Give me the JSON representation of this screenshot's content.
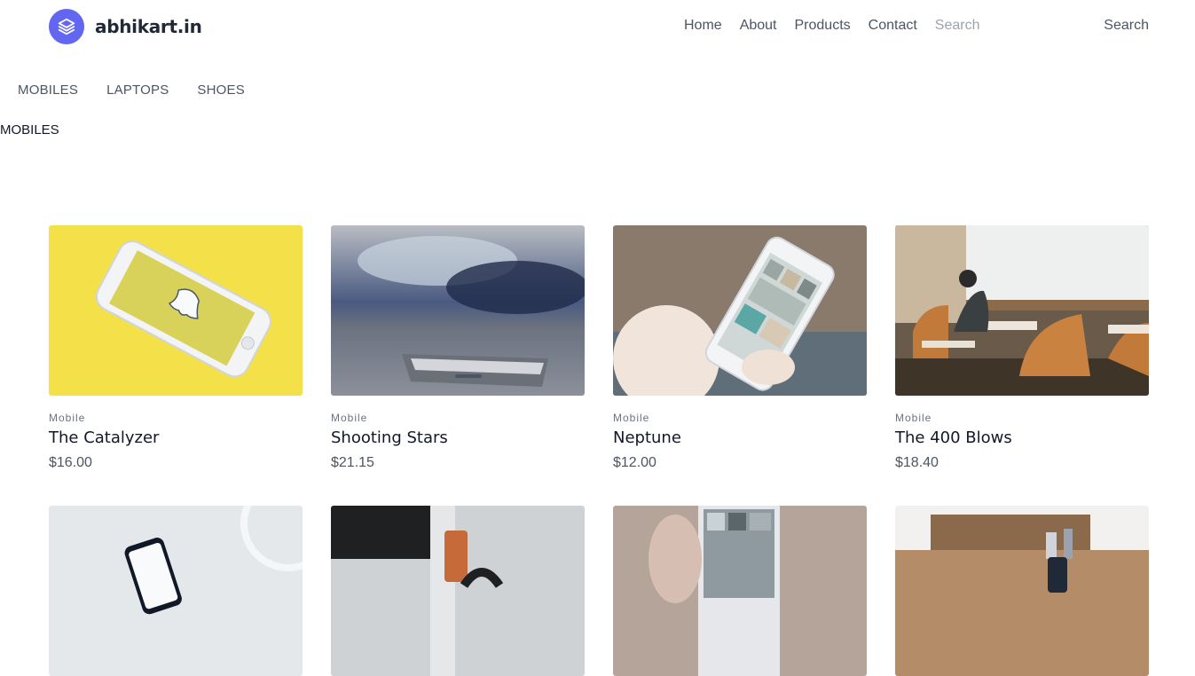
{
  "brand": {
    "name": "abhikart.in",
    "icon": "layers-icon",
    "color": "#6366f1"
  },
  "nav": {
    "links": [
      "Home",
      "About",
      "Products",
      "Contact"
    ],
    "search_placeholder": "Search",
    "search_button": "Search"
  },
  "categories": [
    "MOBILES",
    "LAPTOPS",
    "SHOES"
  ],
  "section_title": "MOBILES",
  "products": [
    {
      "category": "Mobile",
      "title": "The Catalyzer",
      "price": "$16.00"
    },
    {
      "category": "Mobile",
      "title": "Shooting Stars",
      "price": "$21.15"
    },
    {
      "category": "Mobile",
      "title": "Neptune",
      "price": "$12.00"
    },
    {
      "category": "Mobile",
      "title": "The 400 Blows",
      "price": "$18.40"
    }
  ]
}
